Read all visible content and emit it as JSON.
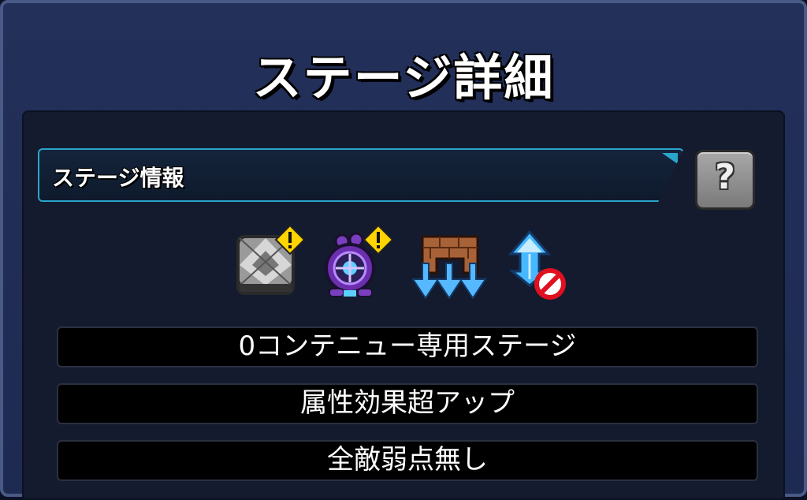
{
  "header": {
    "title": "ステージ詳細"
  },
  "info_bar": {
    "label": "ステージ情報",
    "help_icon": "question-icon",
    "help_symbol": "?"
  },
  "gimmick_icons": [
    {
      "name": "damage-wall-icon",
      "warning": true
    },
    {
      "name": "gravity-barrier-icon",
      "warning": true
    },
    {
      "name": "block-downward-icon",
      "warning": false
    },
    {
      "name": "speed-up-prohibited-icon",
      "warning": false
    }
  ],
  "stage_rules": [
    "0コンテニュー専用ステージ",
    "属性効果超アップ",
    "全敵弱点無し"
  ],
  "colors": {
    "accent": "#2aa6cc",
    "warning": "#ffd400",
    "prohibit": "#e01020"
  }
}
